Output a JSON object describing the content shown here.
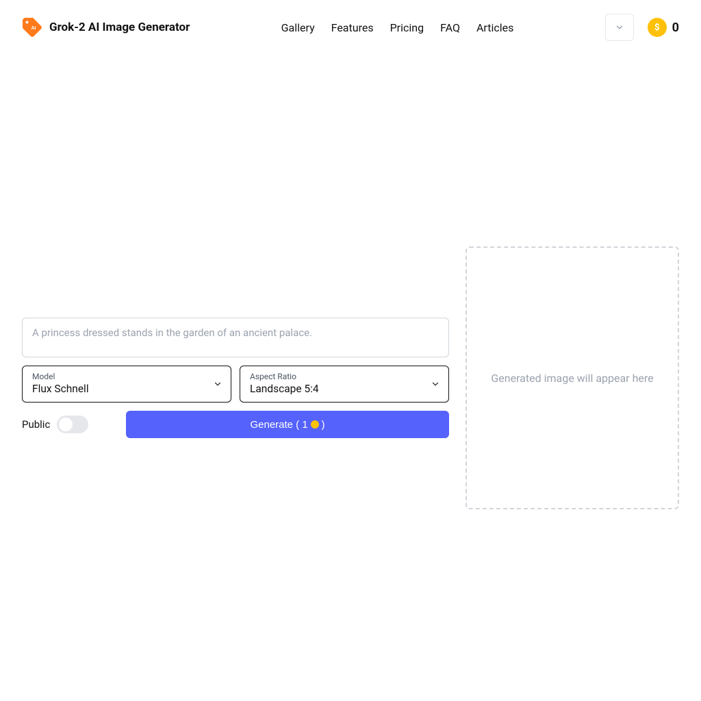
{
  "header": {
    "brand": "Grok-2 AI Image Generator",
    "logo_text": "AI",
    "nav": {
      "gallery": "Gallery",
      "features": "Features",
      "pricing": "Pricing",
      "faq": "FAQ",
      "articles": "Articles"
    },
    "coin_symbol": "$",
    "credits": "0"
  },
  "generator": {
    "prompt_placeholder": "A princess dressed stands in the garden of an ancient palace.",
    "model": {
      "label": "Model",
      "value": "Flux Schnell"
    },
    "aspect_ratio": {
      "label": "Aspect Ratio",
      "value": "Landscape 5:4"
    },
    "public_label": "Public",
    "generate_prefix": "Generate (",
    "generate_cost": "1",
    "generate_suffix": ")",
    "preview_placeholder": "Generated image will appear here"
  }
}
